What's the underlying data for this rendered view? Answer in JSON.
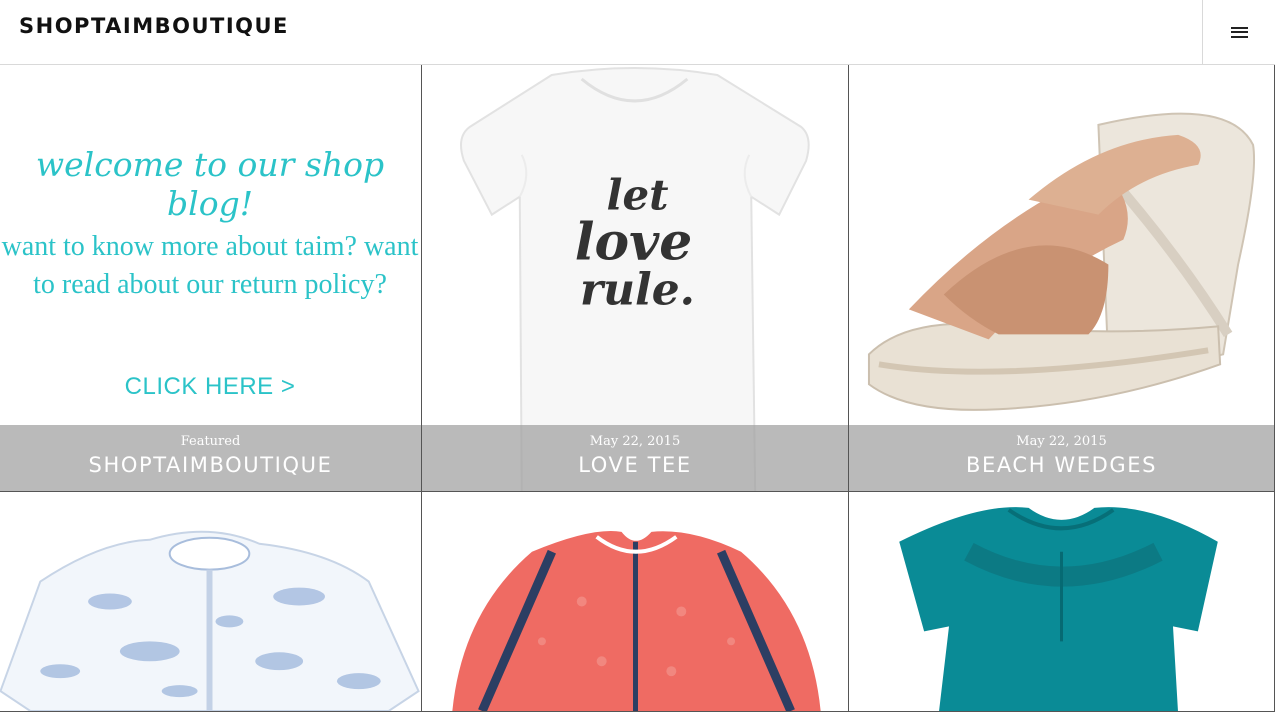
{
  "site": {
    "title": "SHOPTAIMBOUTIQUE"
  },
  "welcome": {
    "line1": "welcome to our shop blog!",
    "line2": "want to know more about taim? want to read about our return policy?",
    "cta": "CLICK HERE >"
  },
  "shirt_print": [
    "let",
    "love",
    "rule."
  ],
  "posts": [
    {
      "meta": "Featured",
      "title": "SHOPTAIMBOUTIQUE"
    },
    {
      "meta": "May 22, 2015",
      "title": "LOVE TEE"
    },
    {
      "meta": "May 22, 2015",
      "title": "BEACH WEDGES"
    }
  ],
  "colors": {
    "welcome_teal": "#2bc3c8",
    "caption_overlay": "#a0a0a0",
    "red_top": "#ef6b63",
    "teal_top": "#0a8b96",
    "wedge_tan": "#d9a587"
  }
}
